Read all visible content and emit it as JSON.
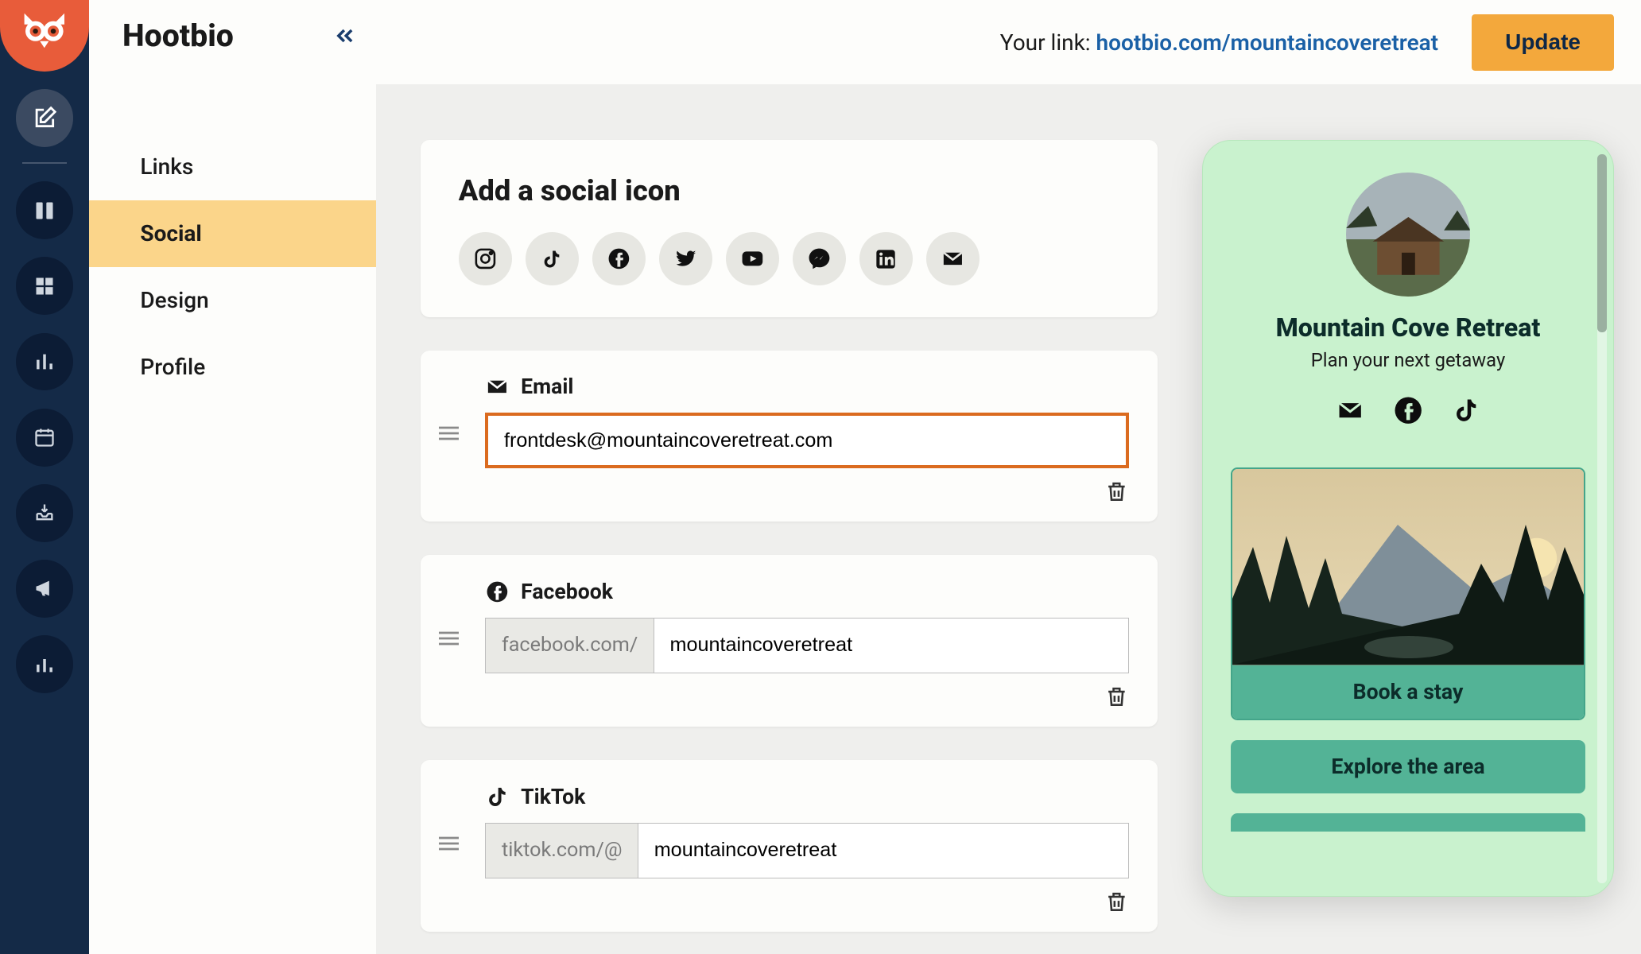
{
  "brand": "Hootbio",
  "sidebar": {
    "items": [
      {
        "label": "Links",
        "active": false
      },
      {
        "label": "Social",
        "active": true
      },
      {
        "label": "Design",
        "active": false
      },
      {
        "label": "Profile",
        "active": false
      }
    ]
  },
  "topbar": {
    "link_label": "Your link:",
    "link_url": "hootbio.com/mountaincoveretreat",
    "update": "Update"
  },
  "add_panel": {
    "title": "Add a social icon",
    "icons": [
      "instagram",
      "tiktok",
      "facebook",
      "twitter",
      "youtube",
      "messenger",
      "linkedin",
      "email"
    ]
  },
  "socials": [
    {
      "type": "Email",
      "prefix": "",
      "value": "frontdesk@mountaincoveretreat.com",
      "highlight": true
    },
    {
      "type": "Facebook",
      "prefix": "facebook.com/",
      "value": "mountaincoveretreat",
      "highlight": false
    },
    {
      "type": "TikTok",
      "prefix": "tiktok.com/@",
      "value": "mountaincoveretreat",
      "highlight": false
    }
  ],
  "preview": {
    "name": "Mountain Cove Retreat",
    "tagline": "Plan your next getaway",
    "social_icons": [
      "email",
      "facebook",
      "tiktok"
    ],
    "link1": "Book a stay",
    "link2": "Explore the area"
  }
}
